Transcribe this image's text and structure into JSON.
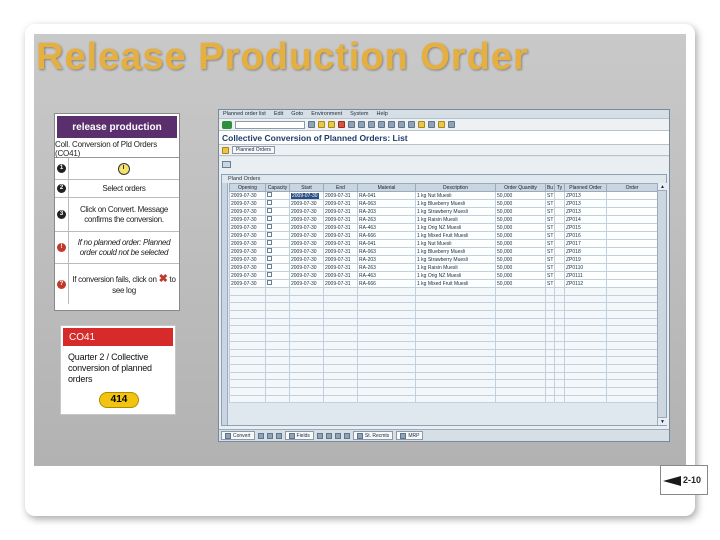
{
  "slide": {
    "title": "Release Production Order",
    "page": "2-10"
  },
  "job_aid": {
    "header": "release production",
    "subheader": "Coll. Conversion of Pld Orders (CO41)",
    "steps": [
      {
        "num": "1",
        "text": "",
        "icon": "clock-icon",
        "color": "#222222"
      },
      {
        "num": "2",
        "text": "Select orders",
        "color": "#222222"
      },
      {
        "num": "3",
        "text": "Click on Convert. Message confirms the conversion.",
        "color": "#222222"
      },
      {
        "num": "!",
        "text": "If no planned order: Planned order could not be selected",
        "color": "#c0392b"
      },
      {
        "num": "?",
        "text_before": "If conversion fails, click on",
        "icon": "x-icon",
        "text_after": "to see log",
        "color": "#c0392b"
      }
    ]
  },
  "co_card": {
    "header": "CO41",
    "line1": "Quarter 2 / Collective",
    "line2": "conversion of planned",
    "line3": "orders",
    "badge": "414",
    "header_color": "#d72b2b",
    "badge_color": "#f2c412"
  },
  "sap": {
    "menu": [
      "Planned order list",
      "Edit",
      "Goto",
      "Environment",
      "System",
      "Help"
    ],
    "screen_title": "Collective Conversion of Planned Orders: List",
    "app_button": "Planned Orders",
    "grid_caption": "Pland Orders",
    "columns": [
      "Opening",
      "Capacity",
      "Start",
      "End",
      "Material",
      "Description",
      "Order Quantity",
      "Bu",
      "Ty",
      "Planned Order",
      "Order"
    ],
    "rows": [
      [
        "2009-07-30",
        "",
        "2009-07-30",
        "2009-07-31",
        "RA-041",
        "1 kg Nut Muesli",
        "50,000",
        "ST",
        "ZP013",
        ""
      ],
      [
        "2009-07-30",
        "",
        "2009-07-30",
        "2009-07-31",
        "RA-063",
        "1 kg Blueberry Muesli",
        "50,000",
        "ST",
        "ZP013",
        ""
      ],
      [
        "2009-07-30",
        "",
        "2009-07-30",
        "2009-07-31",
        "RA-203",
        "1 kg Strawberry Muesli",
        "50,000",
        "ST",
        "ZP013",
        ""
      ],
      [
        "2009-07-30",
        "",
        "2009-07-30",
        "2009-07-31",
        "RA-263",
        "1 kg Raisin Muesli",
        "50,000",
        "ST",
        "ZP014",
        ""
      ],
      [
        "2009-07-30",
        "",
        "2009-07-30",
        "2009-07-31",
        "RA-463",
        "1 kg Orig NZ Muesli",
        "50,000",
        "ST",
        "ZP015",
        ""
      ],
      [
        "2009-07-30",
        "",
        "2009-07-30",
        "2009-07-31",
        "RA-666",
        "1 kg Mixed Fruit Muesli",
        "50,000",
        "ST",
        "ZP016",
        ""
      ],
      [
        "2009-07-30",
        "",
        "2009-07-30",
        "2009-07-31",
        "RA-041",
        "1 kg Nut Muesli",
        "50,000",
        "ST",
        "ZP017",
        ""
      ],
      [
        "2009-07-30",
        "",
        "2009-07-30",
        "2009-07-31",
        "RA-063",
        "1 kg Blueberry Muesli",
        "50,000",
        "ST",
        "ZP018",
        ""
      ],
      [
        "2009-07-30",
        "",
        "2009-07-30",
        "2009-07-31",
        "RA-203",
        "1 kg Strawberry Muesli",
        "50,000",
        "ST",
        "ZP019",
        ""
      ],
      [
        "2009-07-30",
        "",
        "2009-07-30",
        "2009-07-31",
        "RA-263",
        "1 kg Raisin Muesli",
        "50,000",
        "ST",
        "ZP0110",
        ""
      ],
      [
        "2009-07-30",
        "",
        "2009-07-30",
        "2009-07-31",
        "RA-463",
        "1 kg Orig NZ Muesli",
        "50,000",
        "ST",
        "ZP0111",
        ""
      ],
      [
        "2009-07-30",
        "",
        "2009-07-30",
        "2009-07-31",
        "RA-666",
        "1 kg Mixed Fruit Muesli",
        "50,000",
        "ST",
        "ZP0112",
        ""
      ]
    ],
    "empty_rows": 15,
    "footer_buttons": [
      "Convert",
      "Fields",
      "St. Recmts",
      "MRP"
    ]
  }
}
